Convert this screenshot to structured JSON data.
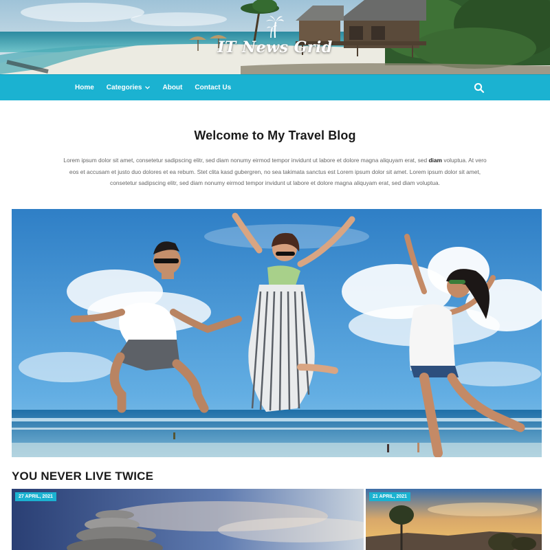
{
  "site": {
    "logo_text": "IT News Grid"
  },
  "nav": {
    "items": [
      {
        "label": "Home"
      },
      {
        "label": "Categories"
      },
      {
        "label": "About"
      },
      {
        "label": "Contact Us"
      }
    ],
    "search_icon": "search-icon",
    "accent_color": "#1bb2d1"
  },
  "intro": {
    "title": "Welcome to My Travel Blog",
    "text_before_bold": "Lorem ipsum dolor sit amet, consetetur sadipscing elitr, sed diam nonumy eirmod tempor invidunt ut labore et dolore magna aliquyam erat, sed ",
    "bold_word": "diam",
    "text_after_bold": " voluptua. At vero eos et accusam et justo duo dolores et ea rebum. Stet clita kasd gubergren, no sea takimata sanctus est Lorem ipsum dolor sit amet. Lorem ipsum dolor sit amet, consetetur sadipscing elitr, sed diam nonumy eirmod tempor invidunt ut labore et dolore magna aliquyam erat, sed diam voluptua."
  },
  "section": {
    "title": "YOU NEVER LIVE TWICE",
    "posts": [
      {
        "date": "27 APRIL, 2021"
      },
      {
        "date": "21 APRIL, 2021"
      }
    ]
  }
}
